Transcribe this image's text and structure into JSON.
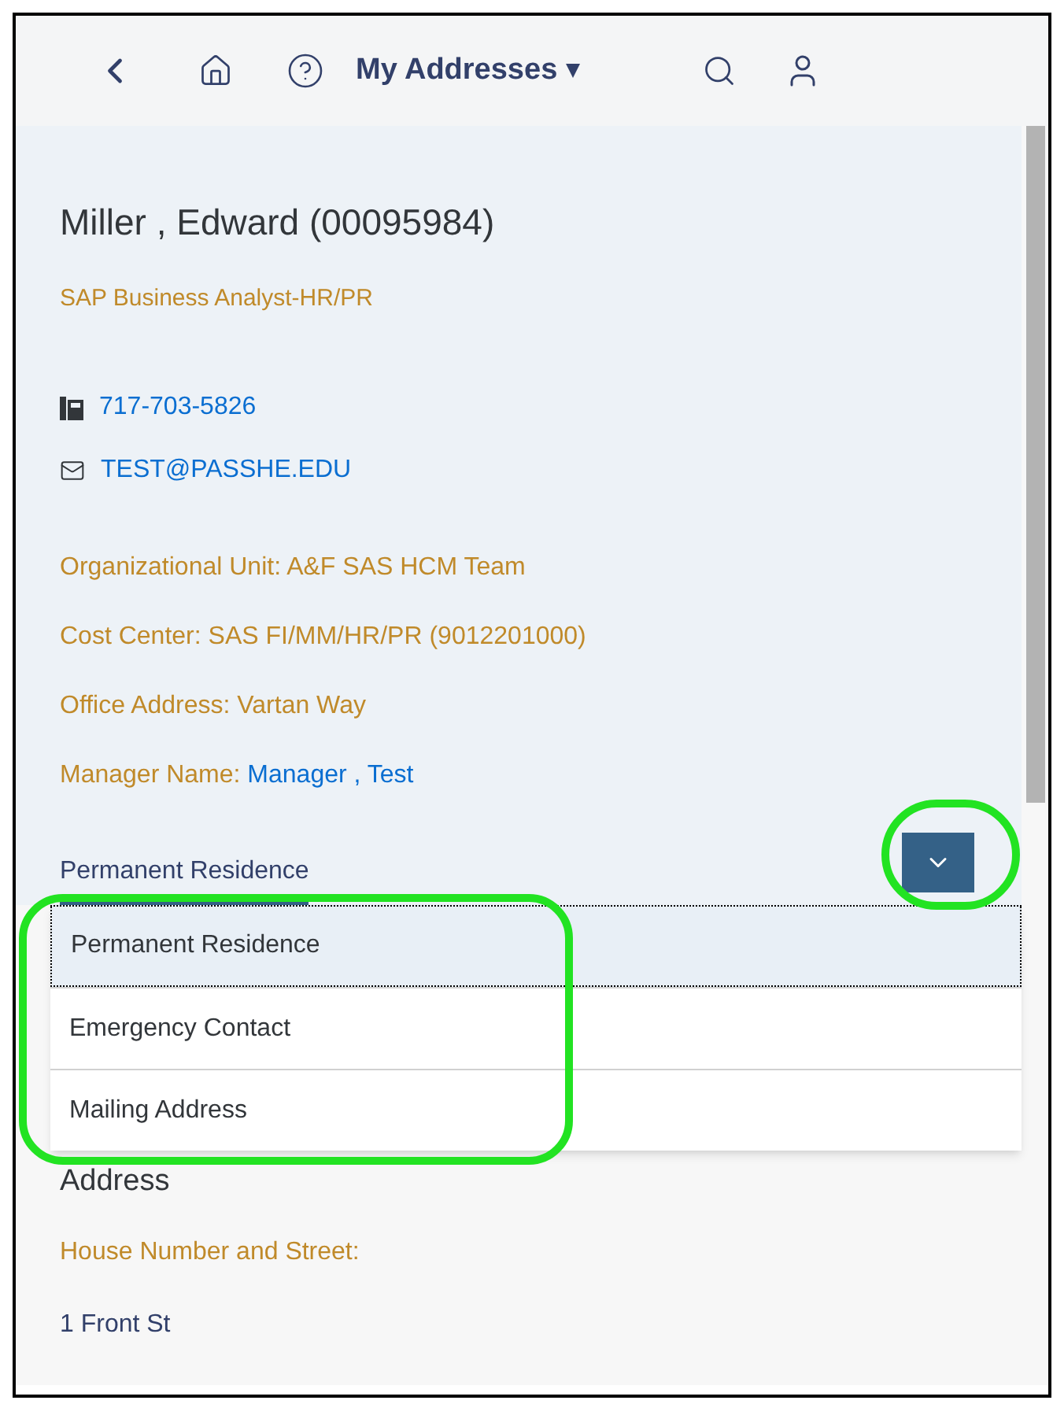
{
  "header": {
    "title": "My Addresses",
    "title_caret": "▾"
  },
  "profile": {
    "name": "Miller , Edward (00095984)",
    "job_title": "SAP Business Analyst-HR/PR",
    "phone": "717-703-5826",
    "email": "TEST@PASSHE.EDU"
  },
  "details": [
    {
      "label": "Organizational Unit:",
      "value": "A&F SAS HCM Team",
      "kind": "text"
    },
    {
      "label": "Cost Center:",
      "value": "SAS FI/MM/HR/PR (9012201000)",
      "kind": "text"
    },
    {
      "label": "Office Address:",
      "value": "Vartan Way",
      "kind": "text"
    },
    {
      "label": "Manager Name:",
      "value": "Manager , Test",
      "kind": "link"
    }
  ],
  "address_type": {
    "value": "Permanent Residence",
    "expanded": true,
    "options": [
      {
        "label": "Permanent Residence",
        "selected": true
      },
      {
        "label": "Emergency Contact",
        "selected": false
      },
      {
        "label": "Mailing Address",
        "selected": false
      }
    ]
  },
  "address": {
    "heading": "Address",
    "fields": [
      {
        "label": "House Number and Street:",
        "value": "1 Front St"
      }
    ]
  }
}
